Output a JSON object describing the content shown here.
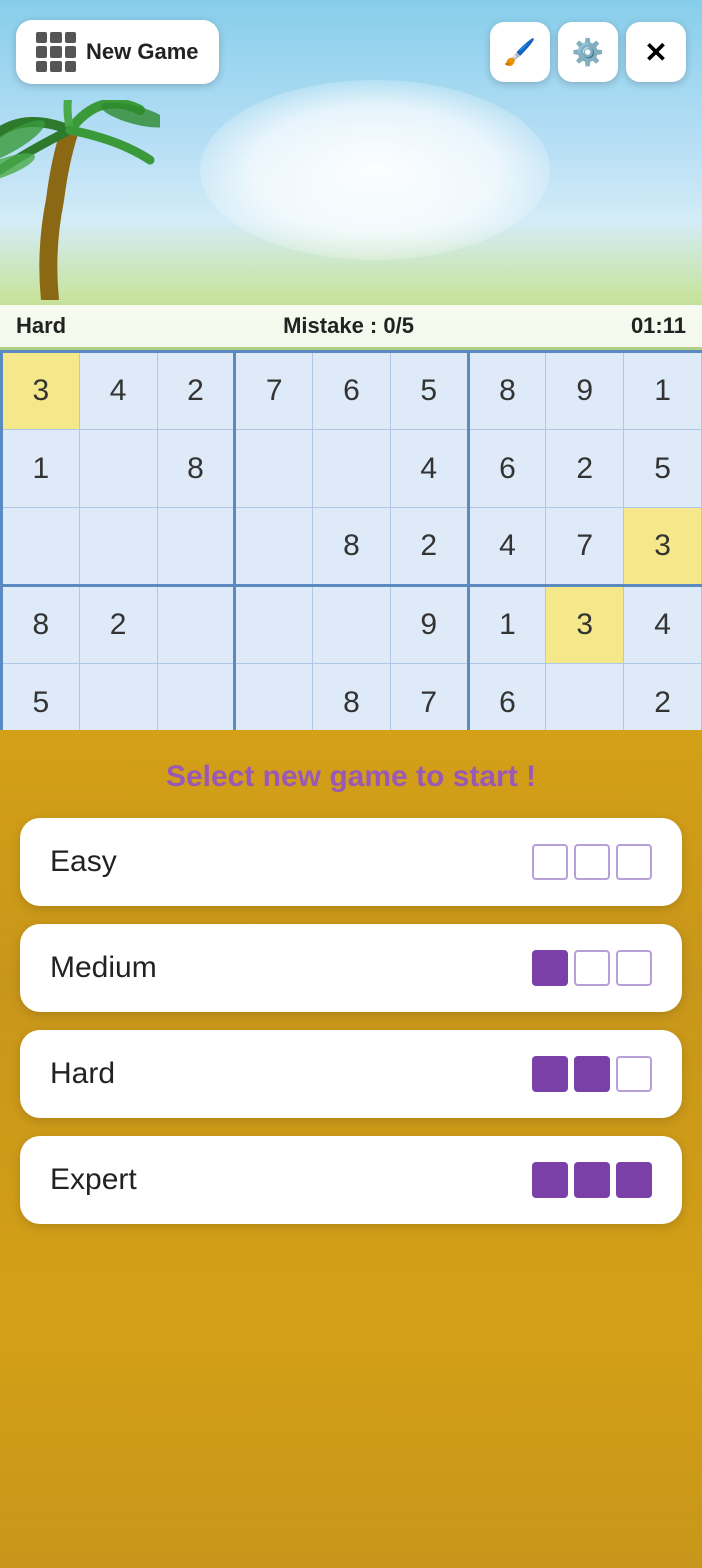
{
  "header": {
    "new_game_label": "New Game",
    "paint_icon": "🖌",
    "settings_icon": "⚙",
    "close_icon": "✕"
  },
  "status": {
    "difficulty": "Hard",
    "mistake_label": "Mistake : 0/5",
    "timer": "01:11"
  },
  "sudoku": {
    "grid": [
      [
        {
          "val": "3",
          "type": "highlight"
        },
        {
          "val": "4",
          "type": "light"
        },
        {
          "val": "2",
          "type": "light"
        },
        {
          "val": "7",
          "type": "light"
        },
        {
          "val": "6",
          "type": "light"
        },
        {
          "val": "5",
          "type": "light"
        },
        {
          "val": "8",
          "type": "light"
        },
        {
          "val": "9",
          "type": "light"
        },
        {
          "val": "1",
          "type": "light"
        }
      ],
      [
        {
          "val": "1",
          "type": "light"
        },
        {
          "val": "",
          "type": "light"
        },
        {
          "val": "8",
          "type": "light"
        },
        {
          "val": "",
          "type": "light"
        },
        {
          "val": "",
          "type": "light"
        },
        {
          "val": "4",
          "type": "light"
        },
        {
          "val": "6",
          "type": "light"
        },
        {
          "val": "2",
          "type": "light"
        },
        {
          "val": "5",
          "type": "light"
        }
      ],
      [
        {
          "val": "",
          "type": "light"
        },
        {
          "val": "",
          "type": "light"
        },
        {
          "val": "",
          "type": "light"
        },
        {
          "val": "",
          "type": "light"
        },
        {
          "val": "8",
          "type": "light"
        },
        {
          "val": "2",
          "type": "light"
        },
        {
          "val": "4",
          "type": "light"
        },
        {
          "val": "7",
          "type": "light"
        },
        {
          "val": "3",
          "type": "highlight"
        }
      ],
      [
        {
          "val": "8",
          "type": "light"
        },
        {
          "val": "2",
          "type": "light"
        },
        {
          "val": "",
          "type": "light"
        },
        {
          "val": "",
          "type": "light"
        },
        {
          "val": "",
          "type": "light"
        },
        {
          "val": "9",
          "type": "light"
        },
        {
          "val": "1",
          "type": "light"
        },
        {
          "val": "3",
          "type": "highlight"
        },
        {
          "val": "4",
          "type": "light"
        }
      ],
      [
        {
          "val": "5",
          "type": "light"
        },
        {
          "val": "",
          "type": "light"
        },
        {
          "val": "",
          "type": "light"
        },
        {
          "val": "",
          "type": "light"
        },
        {
          "val": "8",
          "type": "light"
        },
        {
          "val": "7",
          "type": "light"
        },
        {
          "val": "6",
          "type": "light"
        },
        {
          "val": "",
          "type": "light"
        },
        {
          "val": "2",
          "type": "light"
        }
      ]
    ]
  },
  "overlay": {
    "prompt": "Select new game to start !",
    "difficulties": [
      {
        "label": "Easy",
        "filled": 0,
        "total": 3
      },
      {
        "label": "Medium",
        "filled": 1,
        "total": 3
      },
      {
        "label": "Hard",
        "filled": 2,
        "total": 3
      },
      {
        "label": "Expert",
        "filled": 3,
        "total": 3
      }
    ]
  }
}
